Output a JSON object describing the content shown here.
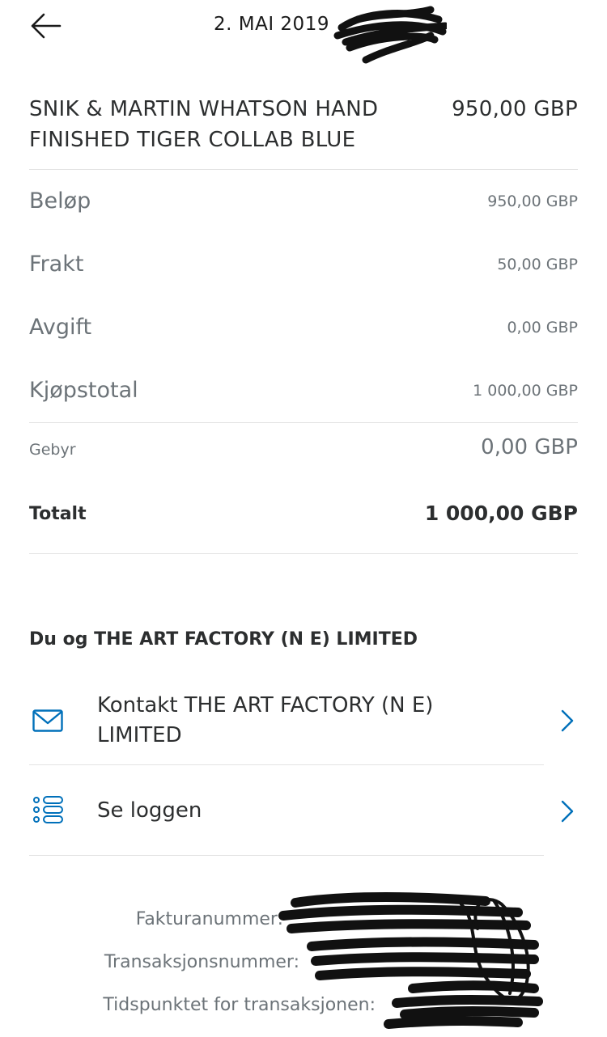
{
  "header": {
    "date": "2. MAI 2019"
  },
  "item": {
    "title": "SNIK & MARTIN WHATSON HAND FINISHED TIGER COLLAB BLUE",
    "price": "950,00 GBP"
  },
  "breakdown": [
    {
      "label": "Beløp",
      "value": "950,00 GBP"
    },
    {
      "label": "Frakt",
      "value": "50,00 GBP"
    },
    {
      "label": "Avgift",
      "value": "0,00 GBP"
    },
    {
      "label": "Kjøpstotal",
      "value": "1 000,00 GBP"
    }
  ],
  "fee": {
    "label": "Gebyr",
    "value": "0,00 GBP"
  },
  "total": {
    "label": "Totalt",
    "value": "1 000,00 GBP"
  },
  "merchant_section": {
    "title": "Du og THE ART FACTORY (N E) LIMITED",
    "actions": [
      {
        "label": "Kontakt THE ART FACTORY (N E) LIMITED",
        "icon": "mail-icon"
      },
      {
        "label": "Se loggen",
        "icon": "list-icon"
      }
    ]
  },
  "meta": {
    "invoice_label": "Fakturanummer:",
    "transaction_label": "Transaksjonsnummer:",
    "time_label": "Tidspunktet for transaksjonen:"
  },
  "colors": {
    "accent": "#0070ba",
    "text_dark": "#2c2e2f",
    "text_muted": "#6c7378",
    "divider": "#e3e3e3"
  }
}
